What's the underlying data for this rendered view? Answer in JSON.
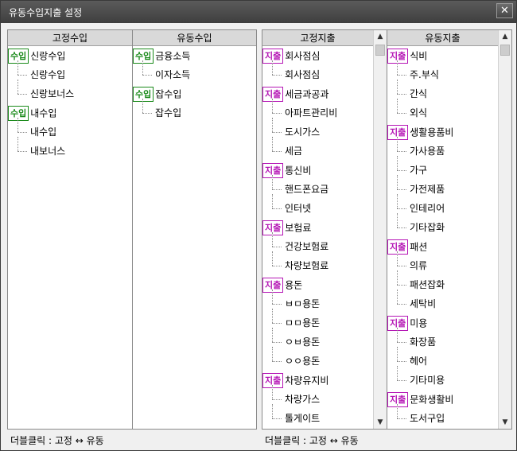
{
  "window": {
    "title": "유동수입지출 설정",
    "close_glyph": "✕"
  },
  "income": {
    "fixed": {
      "header": "고정수입",
      "groups": [
        {
          "badge": "수입",
          "label": "신랑수입",
          "children": [
            "신랑수입",
            "신랑보너스"
          ]
        },
        {
          "badge": "수입",
          "label": "내수입",
          "children": [
            "내수입",
            "내보너스"
          ]
        }
      ]
    },
    "variable": {
      "header": "유동수입",
      "groups": [
        {
          "badge": "수입",
          "label": "금융소득",
          "children": [
            "이자소득"
          ]
        },
        {
          "badge": "수입",
          "label": "잡수입",
          "children": [
            "잡수입"
          ]
        }
      ]
    },
    "footer": "더블클릭 : 고정 ↔ 유동"
  },
  "expense": {
    "fixed": {
      "header": "고정지출",
      "groups": [
        {
          "badge": "지출",
          "label": "회사점심",
          "children": [
            "회사점심"
          ]
        },
        {
          "badge": "지출",
          "label": "세금과공과",
          "children": [
            "아파트관리비",
            "도시가스",
            "세금"
          ]
        },
        {
          "badge": "지출",
          "label": "통신비",
          "children": [
            "핸드폰요금",
            "인터넷"
          ]
        },
        {
          "badge": "지출",
          "label": "보험료",
          "children": [
            "건강보험료",
            "차량보험료"
          ]
        },
        {
          "badge": "지출",
          "label": "용돈",
          "children": [
            "ㅂㅁ용돈",
            "ㅁㅁ용돈",
            "ㅇㅂ용돈",
            "ㅇㅇ용돈"
          ]
        },
        {
          "badge": "지출",
          "label": "차량유지비",
          "children": [
            "차량가스",
            "톨게이트"
          ]
        }
      ]
    },
    "variable": {
      "header": "유동지출",
      "groups": [
        {
          "badge": "지출",
          "label": "식비",
          "children": [
            "주.부식",
            "간식",
            "외식"
          ]
        },
        {
          "badge": "지출",
          "label": "생활용품비",
          "children": [
            "가사용품",
            "가구",
            "가전제품",
            "인테리어",
            "기타잡화"
          ]
        },
        {
          "badge": "지출",
          "label": "패션",
          "children": [
            "의류",
            "패션잡화",
            "세탁비"
          ]
        },
        {
          "badge": "지출",
          "label": "미용",
          "children": [
            "화장품",
            "헤어",
            "기타미용"
          ]
        },
        {
          "badge": "지출",
          "label": "문화생활비",
          "children": [
            "도서구입"
          ]
        }
      ]
    },
    "footer": "더블클릭 : 고정 ↔ 유동"
  },
  "scroll": {
    "up": "▲",
    "down": "▼"
  },
  "colors": {
    "income_badge": "#1a8a1a",
    "expense_badge": "#b516b5",
    "titlebar": "#4a4a4a"
  }
}
